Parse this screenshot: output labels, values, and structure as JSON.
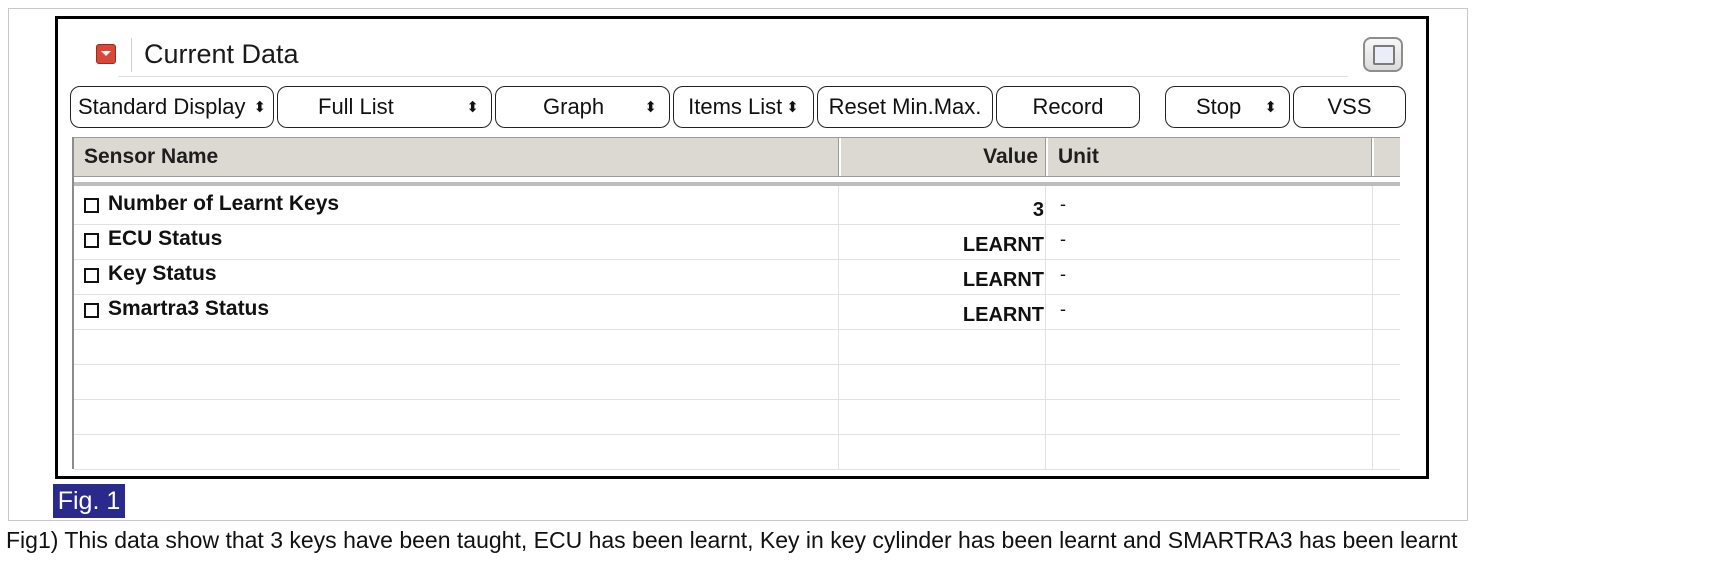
{
  "window": {
    "title": "Current Data"
  },
  "toolbar": {
    "buttons": [
      {
        "label": "Standard Display",
        "selector": "⬍"
      },
      {
        "label": "Full List",
        "selector": "⬍"
      },
      {
        "label": "Graph",
        "selector": "⬍"
      },
      {
        "label": "Items List",
        "selector": "⬍"
      },
      {
        "label": "Reset Min.Max.",
        "selector": ""
      },
      {
        "label": "Record",
        "selector": ""
      },
      {
        "label": "Stop",
        "selector": "⬍"
      },
      {
        "label": "VSS",
        "selector": ""
      }
    ]
  },
  "table": {
    "headers": {
      "name": "Sensor Name",
      "value": "Value",
      "unit": "Unit"
    },
    "rows": [
      {
        "name": "Number of Learnt Keys",
        "value": "3",
        "unit": "-"
      },
      {
        "name": "ECU Status",
        "value": "LEARNT",
        "unit": "-"
      },
      {
        "name": "Key Status",
        "value": "LEARNT",
        "unit": "-"
      },
      {
        "name": "Smartra3 Status",
        "value": "LEARNT",
        "unit": "-"
      }
    ]
  },
  "figure": {
    "label": "Fig. 1",
    "caption": "Fig1) This data show that 3 keys have been taught, ECU has been learnt, Key in key cylinder has been learnt and SMARTRA3 has been learnt"
  },
  "colors": {
    "header_icon": "#d9473a",
    "fig_label_bg": "#2a2a8c",
    "table_header_bg": "#dcd8d2"
  }
}
